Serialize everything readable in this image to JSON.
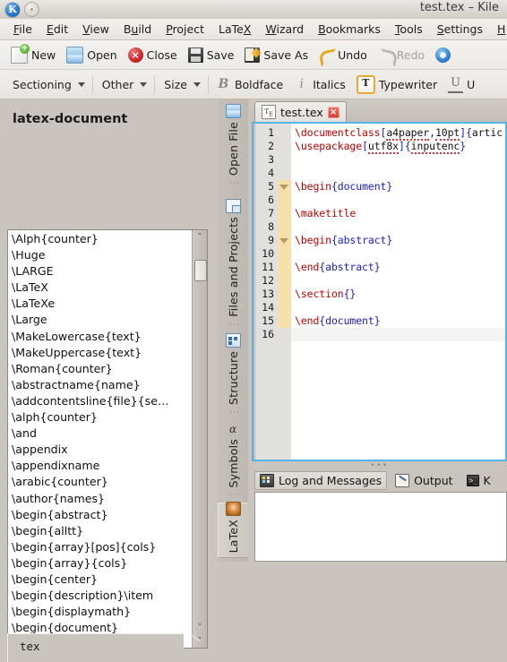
{
  "window": {
    "title": "test.tex – Kile",
    "app_icon": "kile-k-icon",
    "menu_button": "window-menu-button"
  },
  "menubar": {
    "items": [
      {
        "label": "File",
        "accel": "F"
      },
      {
        "label": "Edit",
        "accel": "E"
      },
      {
        "label": "View",
        "accel": "V"
      },
      {
        "label": "Build",
        "accel": "u"
      },
      {
        "label": "Project",
        "accel": "P"
      },
      {
        "label": "LaTeX",
        "accel": "X"
      },
      {
        "label": "Wizard",
        "accel": "W"
      },
      {
        "label": "Bookmarks",
        "accel": "B"
      },
      {
        "label": "Tools",
        "accel": "T"
      },
      {
        "label": "Settings",
        "accel": "S"
      },
      {
        "label": "H",
        "accel": "H"
      }
    ]
  },
  "toolbar_main": {
    "buttons": [
      {
        "label": "New",
        "icon": "new-document-icon",
        "enabled": true
      },
      {
        "label": "Open",
        "icon": "open-folder-icon",
        "enabled": true
      },
      {
        "label": "Close",
        "icon": "close-circle-icon",
        "enabled": true
      },
      {
        "label": "Save",
        "icon": "floppy-save-icon",
        "enabled": true
      },
      {
        "label": "Save As",
        "icon": "save-as-icon",
        "enabled": true
      },
      {
        "label": "Undo",
        "icon": "undo-arrow-icon",
        "enabled": true
      },
      {
        "label": "Redo",
        "icon": "redo-arrow-icon",
        "enabled": false
      },
      {
        "label": "",
        "icon": "gear-icon",
        "enabled": true
      }
    ]
  },
  "toolbar_format": {
    "combos": [
      {
        "label": "Sectioning"
      },
      {
        "label": "Other"
      },
      {
        "label": "Size"
      }
    ],
    "buttons": [
      {
        "label": "Boldface",
        "icon": "bold-b-icon",
        "glyph": "B"
      },
      {
        "label": "Italics",
        "icon": "italic-i-icon",
        "glyph": "i"
      },
      {
        "label": "Typewriter",
        "icon": "typewriter-t-icon",
        "glyph": "T"
      },
      {
        "label": "U",
        "icon": "underline-u-icon",
        "glyph": "U"
      }
    ]
  },
  "left_panel": {
    "title": "latex-document",
    "items": [
      "\\Alph{counter}",
      "\\Huge",
      "\\LARGE",
      "\\LaTeX",
      "\\LaTeXe",
      "\\Large",
      "\\MakeLowercase{text}",
      "\\MakeUppercase{text}",
      "\\Roman{counter}",
      "\\abstractname{name}",
      "\\addcontentsline{file}{se…",
      "\\alph{counter}",
      "\\and",
      "\\appendix",
      "\\appendixname",
      "\\arabic{counter}",
      "\\author{names}",
      "\\begin{abstract}",
      "\\begin{alltt}",
      "\\begin{array}[pos]{cols}",
      "\\begin{array}{cols}",
      "\\begin{center}",
      "\\begin{description}\\item",
      "\\begin{displaymath}",
      "\\begin{document}"
    ],
    "scrollbar": {
      "up_arrow": "˄",
      "down_arrow": "˅"
    },
    "bottom_tab": "tex"
  },
  "side_tabs": {
    "items": [
      {
        "label": "Open File",
        "icon": "open-file-icon",
        "selected": false
      },
      {
        "label": "Files and Projects",
        "icon": "files-projects-icon",
        "selected": false
      },
      {
        "label": "Structure",
        "icon": "structure-icon",
        "selected": false
      },
      {
        "label": "Symbols",
        "icon": "symbols-icon",
        "selected": false
      },
      {
        "label": "LaTeX",
        "icon": "latex-icon",
        "selected": true
      }
    ]
  },
  "editor": {
    "tab": {
      "label": "test.tex",
      "icon": "tex-file-icon",
      "close": "×"
    },
    "current_line": 16,
    "lines": [
      {
        "num": 1,
        "fold": false,
        "tokens": [
          {
            "t": "\\documentclass",
            "c": "cmd"
          },
          {
            "t": "[",
            "c": "brc"
          },
          {
            "t": "a4paper",
            "c": "spell"
          },
          {
            "t": ",",
            "c": "pln"
          },
          {
            "t": "10pt",
            "c": "spell"
          },
          {
            "t": "]",
            "c": "brc"
          },
          {
            "t": "{",
            "c": "brc"
          },
          {
            "t": "artic",
            "c": "pln"
          }
        ]
      },
      {
        "num": 2,
        "fold": false,
        "tokens": [
          {
            "t": "\\usepackage",
            "c": "cmd"
          },
          {
            "t": "[",
            "c": "brc"
          },
          {
            "t": "utf8x",
            "c": "spell"
          },
          {
            "t": "]",
            "c": "brc"
          },
          {
            "t": "{",
            "c": "brc"
          },
          {
            "t": "inputenc",
            "c": "spell"
          },
          {
            "t": "}",
            "c": "brc"
          }
        ]
      },
      {
        "num": 3,
        "fold": false,
        "tokens": []
      },
      {
        "num": 4,
        "fold": false,
        "tokens": []
      },
      {
        "num": 5,
        "fold": true,
        "tokens": [
          {
            "t": "\\begin",
            "c": "cmd"
          },
          {
            "t": "{document}",
            "c": "brc"
          }
        ]
      },
      {
        "num": 6,
        "fold": false,
        "tokens": []
      },
      {
        "num": 7,
        "fold": false,
        "tokens": [
          {
            "t": "\\maketitle",
            "c": "cmd"
          }
        ]
      },
      {
        "num": 8,
        "fold": false,
        "tokens": []
      },
      {
        "num": 9,
        "fold": true,
        "tokens": [
          {
            "t": "\\begin",
            "c": "cmd"
          },
          {
            "t": "{abstract}",
            "c": "brc"
          }
        ]
      },
      {
        "num": 10,
        "fold": false,
        "tokens": []
      },
      {
        "num": 11,
        "fold": false,
        "tokens": [
          {
            "t": "\\end",
            "c": "cmd"
          },
          {
            "t": "{abstract}",
            "c": "brc"
          }
        ]
      },
      {
        "num": 12,
        "fold": false,
        "tokens": []
      },
      {
        "num": 13,
        "fold": false,
        "tokens": [
          {
            "t": "\\section",
            "c": "cmd"
          },
          {
            "t": "{}",
            "c": "brc"
          }
        ]
      },
      {
        "num": 14,
        "fold": false,
        "tokens": []
      },
      {
        "num": 15,
        "fold": false,
        "tokens": [
          {
            "t": "\\end",
            "c": "cmd"
          },
          {
            "t": "{document}",
            "c": "brc"
          }
        ]
      },
      {
        "num": 16,
        "fold": false,
        "tokens": []
      }
    ]
  },
  "bottom_dock": {
    "tabs": [
      {
        "label": "Log and Messages",
        "icon": "log-messages-icon",
        "selected": true
      },
      {
        "label": "Output",
        "icon": "output-icon",
        "selected": false
      },
      {
        "label": "K",
        "icon": "konsole-icon",
        "selected": false
      }
    ]
  },
  "colors": {
    "accent_focus": "#57b4e8",
    "command_red": "#c00000",
    "brace_blue": "#1a1ad0",
    "fold_band": "#f6dfa8",
    "chrome": "#c9c4bd"
  }
}
